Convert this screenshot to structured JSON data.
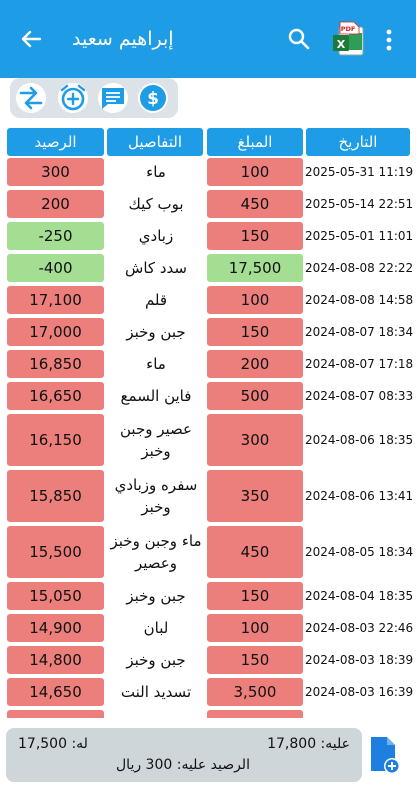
{
  "appbar": {
    "title": "إبراهيم سعيد",
    "pdf_label": "PDF",
    "xls_label": "X"
  },
  "table": {
    "headers": {
      "balance": "الرصيد",
      "details": "التفاصيل",
      "amount": "المبلغ",
      "date": "التاريخ"
    },
    "rows": [
      {
        "balance": "300",
        "details": "ماء",
        "amount": "100",
        "date": "2025-05-31 11:19",
        "balance_status": "red",
        "amount_status": "red"
      },
      {
        "balance": "200",
        "details": "بوب كيك",
        "amount": "450",
        "date": "2025-05-14 22:51",
        "balance_status": "red",
        "amount_status": "red"
      },
      {
        "balance": "-250",
        "details": "زبادي",
        "amount": "150",
        "date": "2025-05-01 11:01",
        "balance_status": "green",
        "amount_status": "red"
      },
      {
        "balance": "-400",
        "details": "سدد كاش",
        "amount": "17,500",
        "date": "2024-08-08 22:22",
        "balance_status": "green",
        "amount_status": "green"
      },
      {
        "balance": "17,100",
        "details": "قلم",
        "amount": "100",
        "date": "2024-08-08 14:58",
        "balance_status": "red",
        "amount_status": "red"
      },
      {
        "balance": "17,000",
        "details": "جبن وخبز",
        "amount": "150",
        "date": "2024-08-07 18:34",
        "balance_status": "red",
        "amount_status": "red"
      },
      {
        "balance": "16,850",
        "details": "ماء",
        "amount": "200",
        "date": "2024-08-07 17:18",
        "balance_status": "red",
        "amount_status": "red"
      },
      {
        "balance": "16,650",
        "details": "فاين السمع",
        "amount": "500",
        "date": "2024-08-07 08:33",
        "balance_status": "red",
        "amount_status": "red"
      },
      {
        "balance": "16,150",
        "details": "عصير وجبن وخبز",
        "amount": "300",
        "date": "2024-08-06 18:35",
        "balance_status": "red",
        "amount_status": "red"
      },
      {
        "balance": "15,850",
        "details": "سفره وزبادي وخبز",
        "amount": "350",
        "date": "2024-08-06 13:41",
        "balance_status": "red",
        "amount_status": "red"
      },
      {
        "balance": "15,500",
        "details": "ماء وجبن وخبز وعصير",
        "amount": "450",
        "date": "2024-08-05 18:34",
        "balance_status": "red",
        "amount_status": "red"
      },
      {
        "balance": "15,050",
        "details": "جبن وخبز",
        "amount": "150",
        "date": "2024-08-04 18:35",
        "balance_status": "red",
        "amount_status": "red"
      },
      {
        "balance": "14,900",
        "details": "لبان",
        "amount": "100",
        "date": "2024-08-03 22:46",
        "balance_status": "red",
        "amount_status": "red"
      },
      {
        "balance": "14,800",
        "details": "جبن وخبز",
        "amount": "150",
        "date": "2024-08-03 18:39",
        "balance_status": "red",
        "amount_status": "red"
      },
      {
        "balance": "14,650",
        "details": "تسديد النت",
        "amount": "3,500",
        "date": "2024-08-03 16:39",
        "balance_status": "red",
        "amount_status": "red"
      },
      {
        "balance": "",
        "details": "",
        "amount": "",
        "date": "",
        "balance_status": "red",
        "amount_status": "red"
      }
    ]
  },
  "summary": {
    "on_him": "عليه: 17,800",
    "for_him": "له: 17,500",
    "balance_text": "الرصيد عليه: 300 ريال"
  },
  "colors": {
    "primary": "#1e9de6",
    "debit": "#ec7f7b",
    "credit": "#a4de93"
  }
}
